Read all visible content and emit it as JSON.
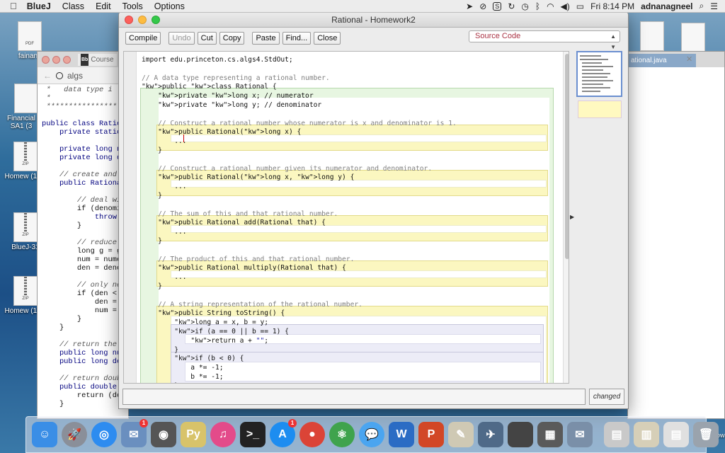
{
  "menubar": {
    "apple_icon": "apple-logo-icon",
    "app_name": "BlueJ",
    "menus": [
      "Class",
      "Edit",
      "Tools",
      "Options"
    ],
    "clock": "Fri 8:14 PM",
    "user": "adnanagneel",
    "tray_icons": [
      "location-icon",
      "circle-slash-icon",
      "s-badge-icon",
      "sync-icon",
      "time-machine-icon",
      "bluetooth-icon",
      "wifi-icon",
      "volume-icon",
      "battery-icon",
      "spotlight-icon",
      "notification-list-icon"
    ]
  },
  "desktop": {
    "icons": [
      {
        "label": "fainanc",
        "kind": "doc",
        "badge": "PDF"
      },
      {
        "label": "Financial SA1 (3",
        "kind": "doc",
        "badge": ""
      },
      {
        "label": "Homew (1).zi",
        "kind": "zip",
        "badge": "ZIP"
      },
      {
        "label": "BlueJ-31",
        "kind": "zip",
        "badge": "ZIP"
      },
      {
        "label": "Homew (1).zi",
        "kind": "zip",
        "badge": "ZIP"
      }
    ],
    "show_label": "Show"
  },
  "browser_back": {
    "tab_label": "Course",
    "url": "algs",
    "code_lines": [
      {
        "text": " *   data type i",
        "cls": "c"
      },
      {
        "text": " *",
        "cls": "c"
      },
      {
        "text": " ****************",
        "cls": "c"
      },
      {
        "text": "",
        "cls": ""
      },
      {
        "text": "public class Ratio",
        "cls": "k"
      },
      {
        "text": "    private static",
        "cls": "k"
      },
      {
        "text": "",
        "cls": ""
      },
      {
        "text": "    private long n",
        "cls": "k"
      },
      {
        "text": "    private long d",
        "cls": "k"
      },
      {
        "text": "",
        "cls": ""
      },
      {
        "text": "    // create and",
        "cls": "c"
      },
      {
        "text": "    public Rationa",
        "cls": "k"
      },
      {
        "text": "",
        "cls": ""
      },
      {
        "text": "        // deal wi",
        "cls": "c"
      },
      {
        "text": "        if (denomi",
        "cls": ""
      },
      {
        "text": "            throw",
        "cls": "k"
      },
      {
        "text": "        }",
        "cls": ""
      },
      {
        "text": "",
        "cls": ""
      },
      {
        "text": "        // reduce",
        "cls": "c"
      },
      {
        "text": "        long g = g",
        "cls": ""
      },
      {
        "text": "        num = nume",
        "cls": ""
      },
      {
        "text": "        den = deno",
        "cls": ""
      },
      {
        "text": "",
        "cls": ""
      },
      {
        "text": "        // only ne",
        "cls": "c"
      },
      {
        "text": "        if (den <",
        "cls": ""
      },
      {
        "text": "            den =",
        "cls": ""
      },
      {
        "text": "            num =",
        "cls": ""
      },
      {
        "text": "        }",
        "cls": ""
      },
      {
        "text": "    }",
        "cls": ""
      },
      {
        "text": "",
        "cls": ""
      },
      {
        "text": "    // return the",
        "cls": "c"
      },
      {
        "text": "    public long nu",
        "cls": "k"
      },
      {
        "text": "    public long de",
        "cls": "k"
      },
      {
        "text": "",
        "cls": ""
      },
      {
        "text": "    // return doub",
        "cls": "c"
      },
      {
        "text": "    public double",
        "cls": "k"
      },
      {
        "text": "        return (do",
        "cls": ""
      },
      {
        "text": "    }",
        "cls": ""
      }
    ]
  },
  "browser_right": {
    "tab_label": "ational.java"
  },
  "window": {
    "title": "Rational - Homework2",
    "toolbar": {
      "compile": "Compile",
      "undo": "Undo",
      "cut": "Cut",
      "copy": "Copy",
      "paste": "Paste",
      "find": "Find...",
      "close": "Close"
    },
    "view_select": "Source Code",
    "status": "changed"
  },
  "editor": {
    "lines": [
      {
        "t": "import edu.princeton.cs.algs4.StdOut;",
        "cls": ""
      },
      {
        "t": "",
        "cls": ""
      },
      {
        "t": "// A data type representing a rational number.",
        "cls": "cm"
      },
      {
        "t": "public class Rational {",
        "cls": ""
      },
      {
        "t": "    private long x; // numerator",
        "cls": ""
      },
      {
        "t": "    private long y; // denominator",
        "cls": ""
      },
      {
        "t": "",
        "cls": ""
      },
      {
        "t": "    // Construct a rational number whose numerator is x and denominator is 1.",
        "cls": "cm"
      },
      {
        "t": "    public Rational(long x) {",
        "cls": ""
      },
      {
        "t": "        ...",
        "cls": ""
      },
      {
        "t": "    }",
        "cls": ""
      },
      {
        "t": "",
        "cls": ""
      },
      {
        "t": "    // Construct a rational number given its numerator and denominator.",
        "cls": "cm"
      },
      {
        "t": "    public Rational(long x, long y) {",
        "cls": ""
      },
      {
        "t": "        ...",
        "cls": ""
      },
      {
        "t": "    }",
        "cls": ""
      },
      {
        "t": "",
        "cls": ""
      },
      {
        "t": "    // The sum of this and that rational number.",
        "cls": "cm"
      },
      {
        "t": "    public Rational add(Rational that) {",
        "cls": ""
      },
      {
        "t": "        ...",
        "cls": ""
      },
      {
        "t": "    }",
        "cls": ""
      },
      {
        "t": "",
        "cls": ""
      },
      {
        "t": "    // The product of this and that rational number.",
        "cls": "cm"
      },
      {
        "t": "    public Rational multiply(Rational that) {",
        "cls": ""
      },
      {
        "t": "        ...",
        "cls": ""
      },
      {
        "t": "    }",
        "cls": ""
      },
      {
        "t": "",
        "cls": ""
      },
      {
        "t": "    // A string representation of the rational number.",
        "cls": "cm"
      },
      {
        "t": "    public String toString() {",
        "cls": ""
      },
      {
        "t": "        long a = x, b = y;",
        "cls": ""
      },
      {
        "t": "        if (a == 0 || b == 1) {",
        "cls": ""
      },
      {
        "t": "            return a + \"\";",
        "cls": ""
      },
      {
        "t": "        }",
        "cls": ""
      },
      {
        "t": "        if (b < 0) {",
        "cls": ""
      },
      {
        "t": "            a *= -1;",
        "cls": ""
      },
      {
        "t": "            b *= -1;",
        "cls": ""
      },
      {
        "t": "        }",
        "cls": ""
      }
    ]
  },
  "dock": {
    "apps": [
      {
        "name": "finder-icon",
        "glyph": "☺",
        "color": "#3a8ee6",
        "round": false,
        "badge": ""
      },
      {
        "name": "launchpad-icon",
        "glyph": "🚀",
        "color": "#8a8f99",
        "round": true,
        "badge": ""
      },
      {
        "name": "safari-icon",
        "glyph": "◎",
        "color": "#2d8cf0",
        "round": true,
        "badge": ""
      },
      {
        "name": "mail-stamp-icon",
        "glyph": "✉",
        "color": "#6a8fbf",
        "round": false,
        "badge": "1"
      },
      {
        "name": "camera-icon",
        "glyph": "◉",
        "color": "#555",
        "round": false,
        "badge": ""
      },
      {
        "name": "python-icon",
        "glyph": "Py",
        "color": "#d8c36a",
        "round": false,
        "badge": ""
      },
      {
        "name": "itunes-icon",
        "glyph": "♫",
        "color": "#e34b8a",
        "round": true,
        "badge": ""
      },
      {
        "name": "terminal-icon",
        "glyph": ">_",
        "color": "#222",
        "round": false,
        "badge": ""
      },
      {
        "name": "app-store-icon",
        "glyph": "A",
        "color": "#1d8df0",
        "round": true,
        "badge": "1"
      },
      {
        "name": "chrome-icon",
        "glyph": "●",
        "color": "#db4437",
        "round": true,
        "badge": ""
      },
      {
        "name": "atom-icon",
        "glyph": "⚛",
        "color": "#3fa34d",
        "round": true,
        "badge": ""
      },
      {
        "name": "messages-icon",
        "glyph": "💬",
        "color": "#4aa5f0",
        "round": true,
        "badge": ""
      },
      {
        "name": "word-icon",
        "glyph": "W",
        "color": "#2b6cc4",
        "round": false,
        "badge": ""
      },
      {
        "name": "powerpoint-icon",
        "glyph": "P",
        "color": "#d24726",
        "round": false,
        "badge": ""
      },
      {
        "name": "script-editor-icon",
        "glyph": "✎",
        "color": "#cfc9b4",
        "round": false,
        "badge": ""
      },
      {
        "name": "bluej-bird-icon",
        "glyph": "✈",
        "color": "#4f6a88",
        "round": false,
        "badge": ""
      },
      {
        "name": "blank-window-icon",
        "glyph": "",
        "color": "#444",
        "round": false,
        "badge": ""
      },
      {
        "name": "photo-thumbnail-icon",
        "glyph": "▦",
        "color": "#5a5a5a",
        "round": false,
        "badge": ""
      },
      {
        "name": "preview-icon",
        "glyph": "✉",
        "color": "#7a8fa8",
        "round": false,
        "badge": ""
      },
      {
        "name": "downloads-stack-icon",
        "glyph": "▤",
        "color": "#c9c9c9",
        "round": false,
        "badge": ""
      },
      {
        "name": "documents-stack-icon",
        "glyph": "▥",
        "color": "#d6cfb8",
        "round": false,
        "badge": ""
      },
      {
        "name": "files-stack-icon",
        "glyph": "▤",
        "color": "#e0e0e0",
        "round": false,
        "badge": ""
      },
      {
        "name": "trash-icon",
        "glyph": "🗑",
        "color": "#9aa3ad",
        "round": false,
        "badge": ""
      }
    ]
  }
}
